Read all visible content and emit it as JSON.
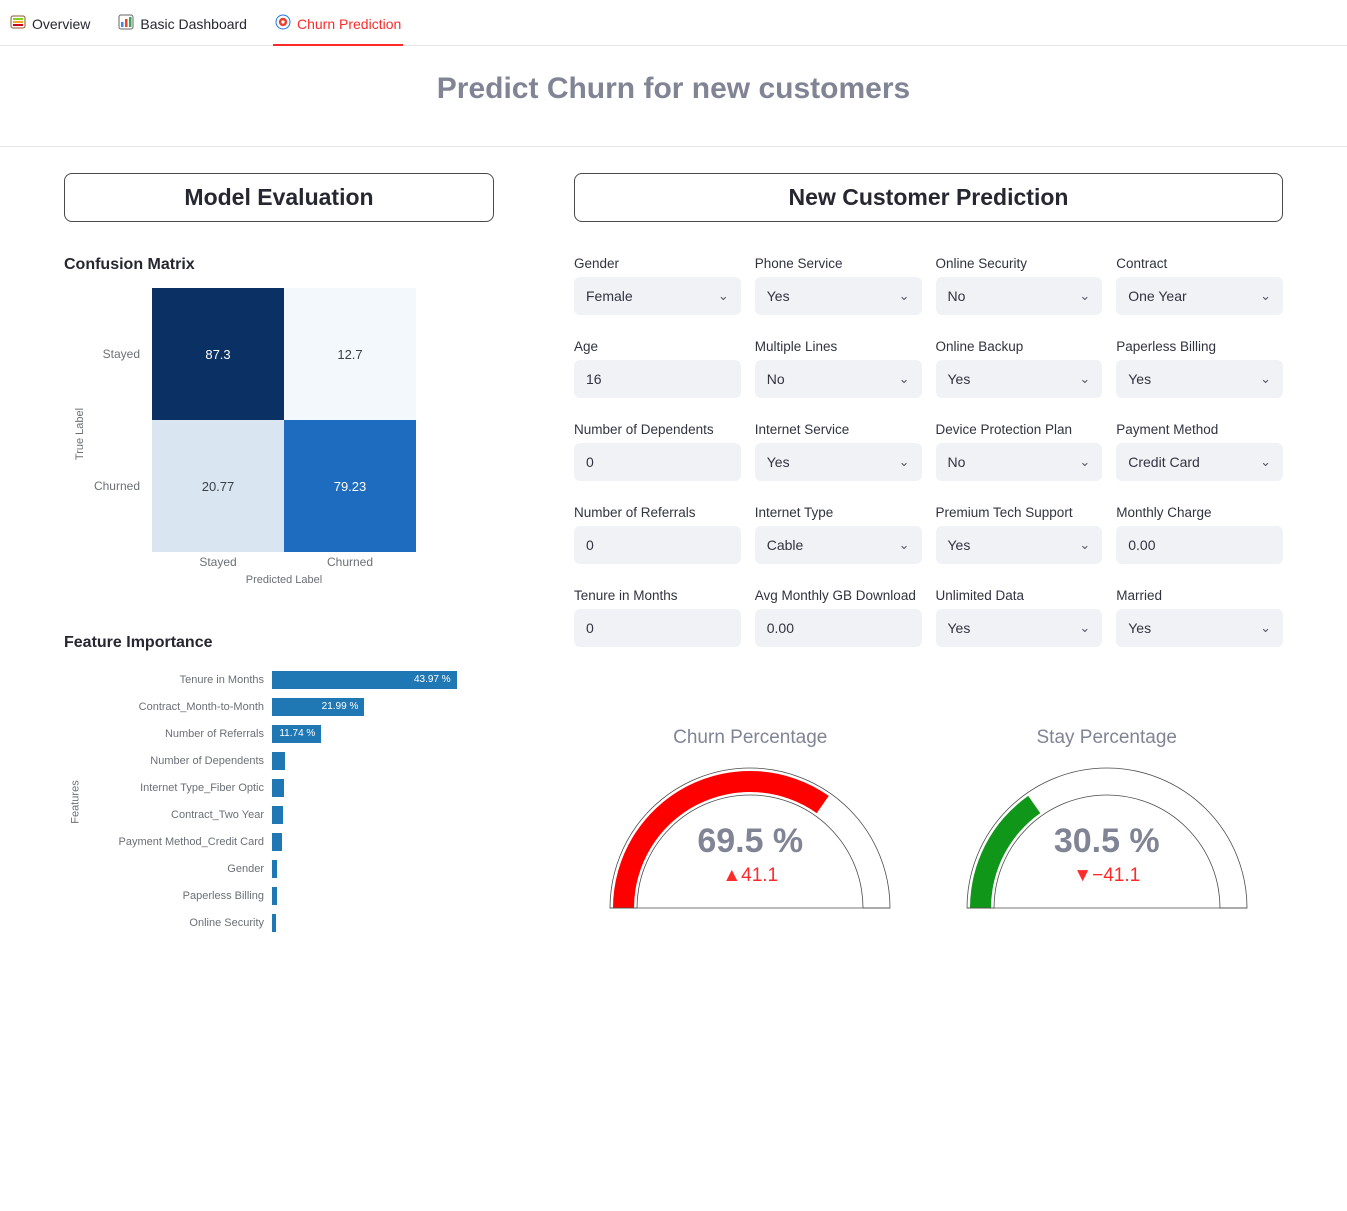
{
  "tabs": [
    {
      "label": "Overview",
      "active": false
    },
    {
      "label": "Basic Dashboard",
      "active": false
    },
    {
      "label": "Churn Prediction",
      "active": true
    }
  ],
  "page_title": "Predict Churn for new customers",
  "left": {
    "title": "Model Evaluation",
    "confusion": {
      "heading": "Confusion Matrix",
      "y_axis": "True Label",
      "x_axis": "Predicted Label",
      "row_labels": [
        "Stayed",
        "Churned"
      ],
      "col_labels": [
        "Stayed",
        "Churned"
      ],
      "cells": [
        [
          87.3,
          12.7
        ],
        [
          20.77,
          79.23
        ]
      ]
    },
    "feature_importance": {
      "heading": "Feature Importance",
      "y_axis": "Features"
    }
  },
  "right": {
    "title": "New Customer Prediction",
    "fields": [
      {
        "label": "Gender",
        "type": "select",
        "value": "Female"
      },
      {
        "label": "Phone Service",
        "type": "select",
        "value": "Yes"
      },
      {
        "label": "Online Security",
        "type": "select",
        "value": "No"
      },
      {
        "label": "Contract",
        "type": "select",
        "value": "One Year"
      },
      {
        "label": "Age",
        "type": "text",
        "value": "16"
      },
      {
        "label": "Multiple Lines",
        "type": "select",
        "value": "No"
      },
      {
        "label": "Online Backup",
        "type": "select",
        "value": "Yes"
      },
      {
        "label": "Paperless Billing",
        "type": "select",
        "value": "Yes"
      },
      {
        "label": "Number of Dependents",
        "type": "text",
        "value": "0"
      },
      {
        "label": "Internet Service",
        "type": "select",
        "value": "Yes"
      },
      {
        "label": "Device Protection Plan",
        "type": "select",
        "value": "No"
      },
      {
        "label": "Payment Method",
        "type": "select",
        "value": "Credit Card"
      },
      {
        "label": "Number of Referrals",
        "type": "text",
        "value": "0"
      },
      {
        "label": "Internet Type",
        "type": "select",
        "value": "Cable"
      },
      {
        "label": "Premium Tech Support",
        "type": "select",
        "value": "Yes"
      },
      {
        "label": "Monthly Charge",
        "type": "text",
        "value": "0.00"
      },
      {
        "label": "Tenure in Months",
        "type": "text",
        "value": "0"
      },
      {
        "label": "Avg Monthly GB Download",
        "type": "text",
        "value": "0.00"
      },
      {
        "label": "Unlimited Data",
        "type": "select",
        "value": "Yes"
      },
      {
        "label": "Married",
        "type": "select",
        "value": "Yes"
      }
    ],
    "gauges": {
      "churn": {
        "title": "Churn Percentage",
        "value": "69.5 %",
        "frac": 0.695,
        "delta": "▲41.1",
        "color": "#ff0000"
      },
      "stay": {
        "title": "Stay Percentage",
        "value": "30.5 %",
        "frac": 0.305,
        "delta": "▼−41.1",
        "color": "#109618"
      }
    }
  },
  "chart_data": [
    {
      "type": "heatmap",
      "title": "Confusion Matrix",
      "xlabel": "Predicted Label",
      "ylabel": "True Label",
      "x_categories": [
        "Stayed",
        "Churned"
      ],
      "y_categories": [
        "Stayed",
        "Churned"
      ],
      "values": [
        [
          87.3,
          12.7
        ],
        [
          20.77,
          79.23
        ]
      ]
    },
    {
      "type": "bar",
      "orientation": "horizontal",
      "title": "Feature Importance",
      "ylabel": "Features",
      "categories": [
        "Tenure in Months",
        "Contract_Month-to-Month",
        "Number of Referrals",
        "Number of Dependents",
        "Internet Type_Fiber Optic",
        "Contract_Two Year",
        "Payment Method_Credit Card",
        "Gender",
        "Paperless Billing",
        "Online Security"
      ],
      "values": [
        43.97,
        21.99,
        11.74,
        3.2,
        2.9,
        2.6,
        2.3,
        1.2,
        1.1,
        1.0
      ],
      "value_suffix": " %",
      "label_visible_threshold": 5,
      "xlim": [
        0,
        50
      ]
    },
    {
      "type": "gauge",
      "title": "Churn Percentage",
      "value": 69.5,
      "range": [
        0,
        100
      ],
      "delta": 41.1,
      "color": "#ff0000"
    },
    {
      "type": "gauge",
      "title": "Stay Percentage",
      "value": 30.5,
      "range": [
        0,
        100
      ],
      "delta": -41.1,
      "color": "#109618"
    }
  ]
}
